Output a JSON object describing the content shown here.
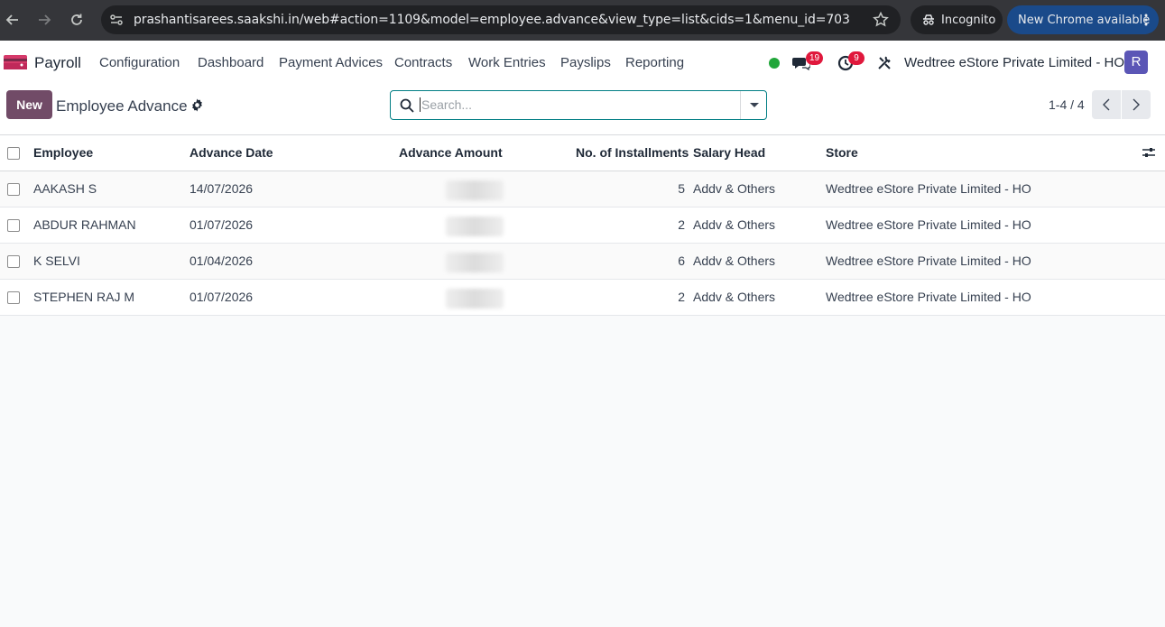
{
  "browser": {
    "url": "prashantisarees.saakshi.in/web#action=1109&model=employee.advance&view_type=list&cids=1&menu_id=703",
    "incognito_label": "Incognito",
    "update_label": "New Chrome available"
  },
  "nav": {
    "app_name": "Payroll",
    "menu": [
      "Configuration",
      "Dashboard",
      "Payment Advices",
      "Contracts",
      "Work Entries",
      "Payslips",
      "Reporting"
    ],
    "messages_count": "19",
    "activities_count": "9",
    "company": "Wedtree eStore Private Limited - HO",
    "avatar_letter": "R"
  },
  "control": {
    "new_label": "New",
    "title": "Employee Advance",
    "search_placeholder": "Search...",
    "pager": "1-4 / 4"
  },
  "table": {
    "headers": {
      "employee": "Employee",
      "advance_date": "Advance Date",
      "advance_amount": "Advance Amount",
      "installments": "No. of Installments",
      "salary_head": "Salary Head",
      "store": "Store"
    },
    "rows": [
      {
        "employee": "AAKASH S",
        "date": "14/07/2026",
        "installments": "5",
        "salary_head": "Addv & Others",
        "store": "Wedtree eStore Private Limited - HO"
      },
      {
        "employee": "ABDUR RAHMAN",
        "date": "01/07/2026",
        "installments": "2",
        "salary_head": "Addv & Others",
        "store": "Wedtree eStore Private Limited - HO"
      },
      {
        "employee": "K SELVI",
        "date": "01/04/2026",
        "installments": "6",
        "salary_head": "Addv & Others",
        "store": "Wedtree eStore Private Limited - HO"
      },
      {
        "employee": "STEPHEN RAJ M",
        "date": "01/07/2026",
        "installments": "2",
        "salary_head": "Addv & Others",
        "store": "Wedtree eStore Private Limited - HO"
      }
    ]
  },
  "colors": {
    "brand": "#714b67",
    "search_border": "#017e84",
    "badge": "#e0183c",
    "online": "#21a63a",
    "avatar": "#5b56b6"
  }
}
